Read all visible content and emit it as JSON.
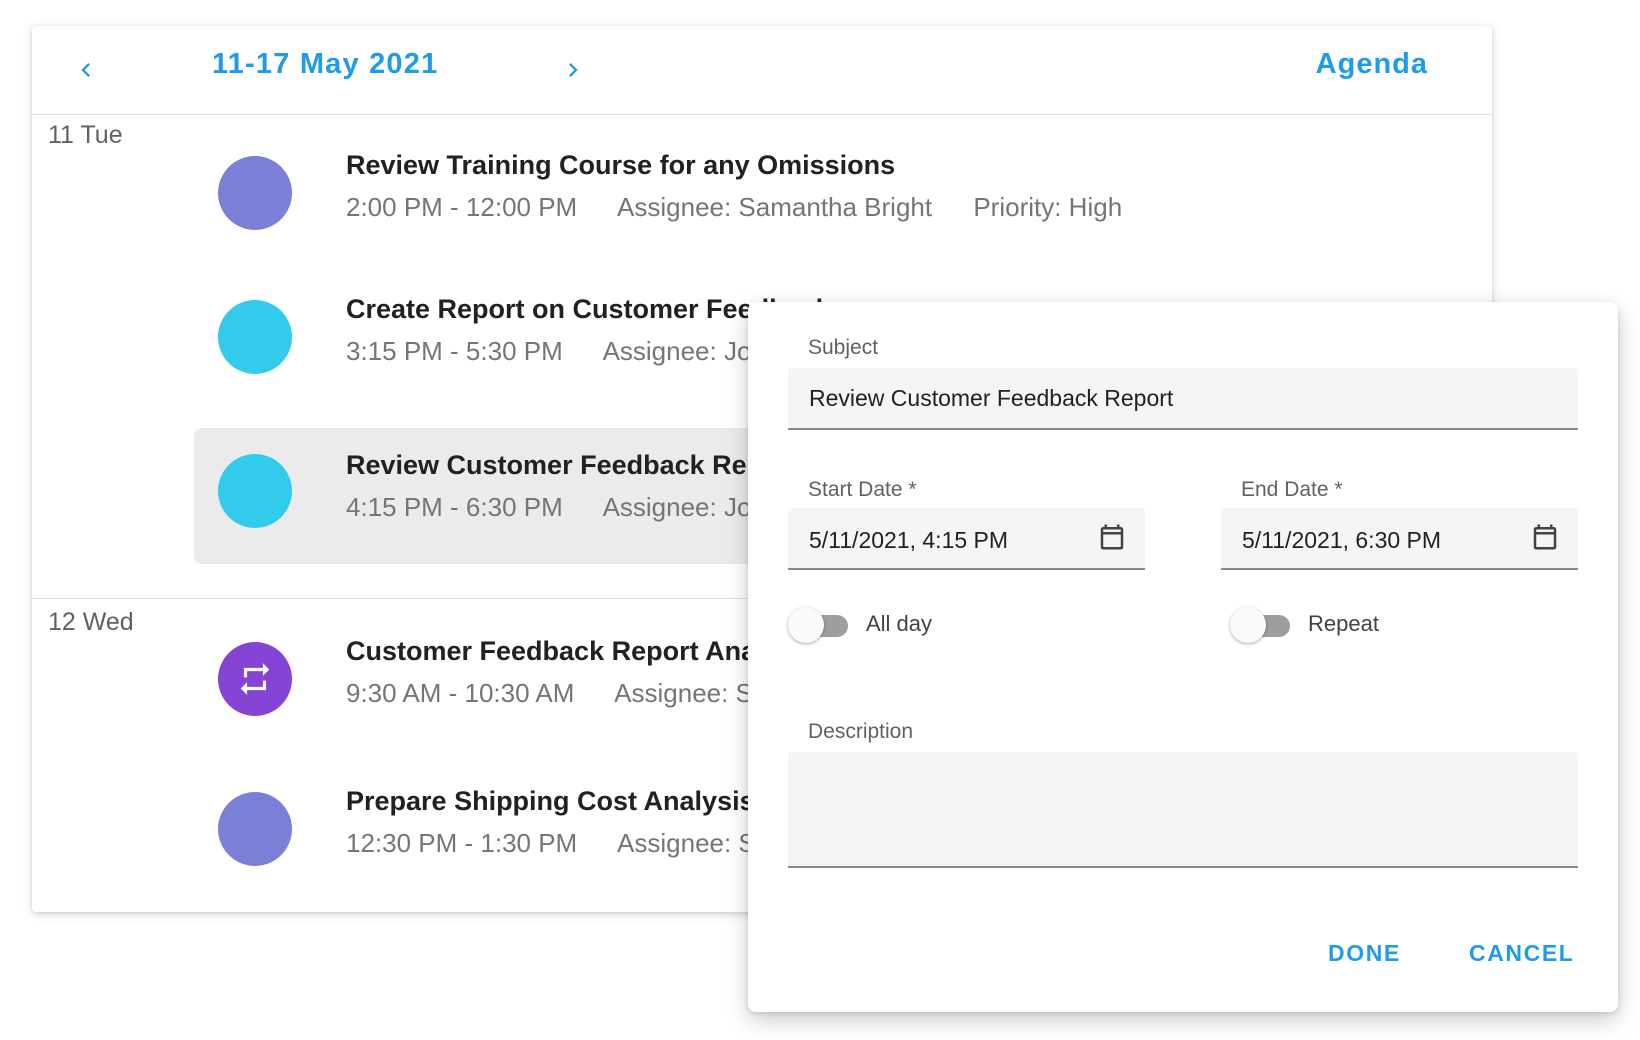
{
  "colors": {
    "accent": "#1e9be9",
    "appointment_purple_light": "#7a80d6",
    "appointment_cyan": "#33cbec",
    "appointment_purple": "#8644d5",
    "selected_bg": "#ebebeb"
  },
  "header": {
    "prev_icon": "chevron-left-icon",
    "date_range": "11-17 May 2021",
    "next_icon": "chevron-right-icon",
    "view": "Agenda"
  },
  "days": [
    {
      "label": "11 Tue",
      "appointments": [
        {
          "title": "Review Training Course for any Omissions",
          "time": "2:00 PM - 12:00 PM",
          "assignee": "Assignee: Samantha Bright",
          "priority": "Priority: High",
          "color": "#7a80d6",
          "selected": false
        },
        {
          "title": "Create Report on Customer Feedback",
          "time": "3:15 PM - 5:30 PM",
          "assignee": "Assignee: John",
          "color": "#33cbec",
          "selected": false
        },
        {
          "title": "Review Customer Feedback Report",
          "time": "4:15 PM - 6:30 PM",
          "assignee": "Assignee: John",
          "color": "#33cbec",
          "selected": true
        }
      ]
    },
    {
      "label": "12 Wed",
      "appointments": [
        {
          "title": "Customer Feedback Report Analysis",
          "time": "9:30 AM - 10:30 AM",
          "assignee": "Assignee: Samantha",
          "color": "#8644d5",
          "icon": "repeat-icon",
          "selected": false
        },
        {
          "title": "Prepare Shipping Cost Analysis",
          "time": "12:30 PM - 1:30 PM",
          "assignee": "Assignee: Samantha",
          "color": "#7a80d6",
          "selected": false
        }
      ]
    }
  ],
  "dialog": {
    "subject": {
      "label": "Subject",
      "value": "Review Customer Feedback Report"
    },
    "start_date": {
      "label": "Start Date *",
      "value": "5/11/2021, 4:15 PM",
      "icon": "calendar-icon"
    },
    "end_date": {
      "label": "End Date *",
      "value": "5/11/2021, 6:30 PM",
      "icon": "calendar-icon"
    },
    "all_day": {
      "label": "All day",
      "checked": false
    },
    "repeat": {
      "label": "Repeat",
      "checked": false
    },
    "description": {
      "label": "Description",
      "value": ""
    },
    "done_label": "DONE",
    "cancel_label": "CANCEL"
  }
}
